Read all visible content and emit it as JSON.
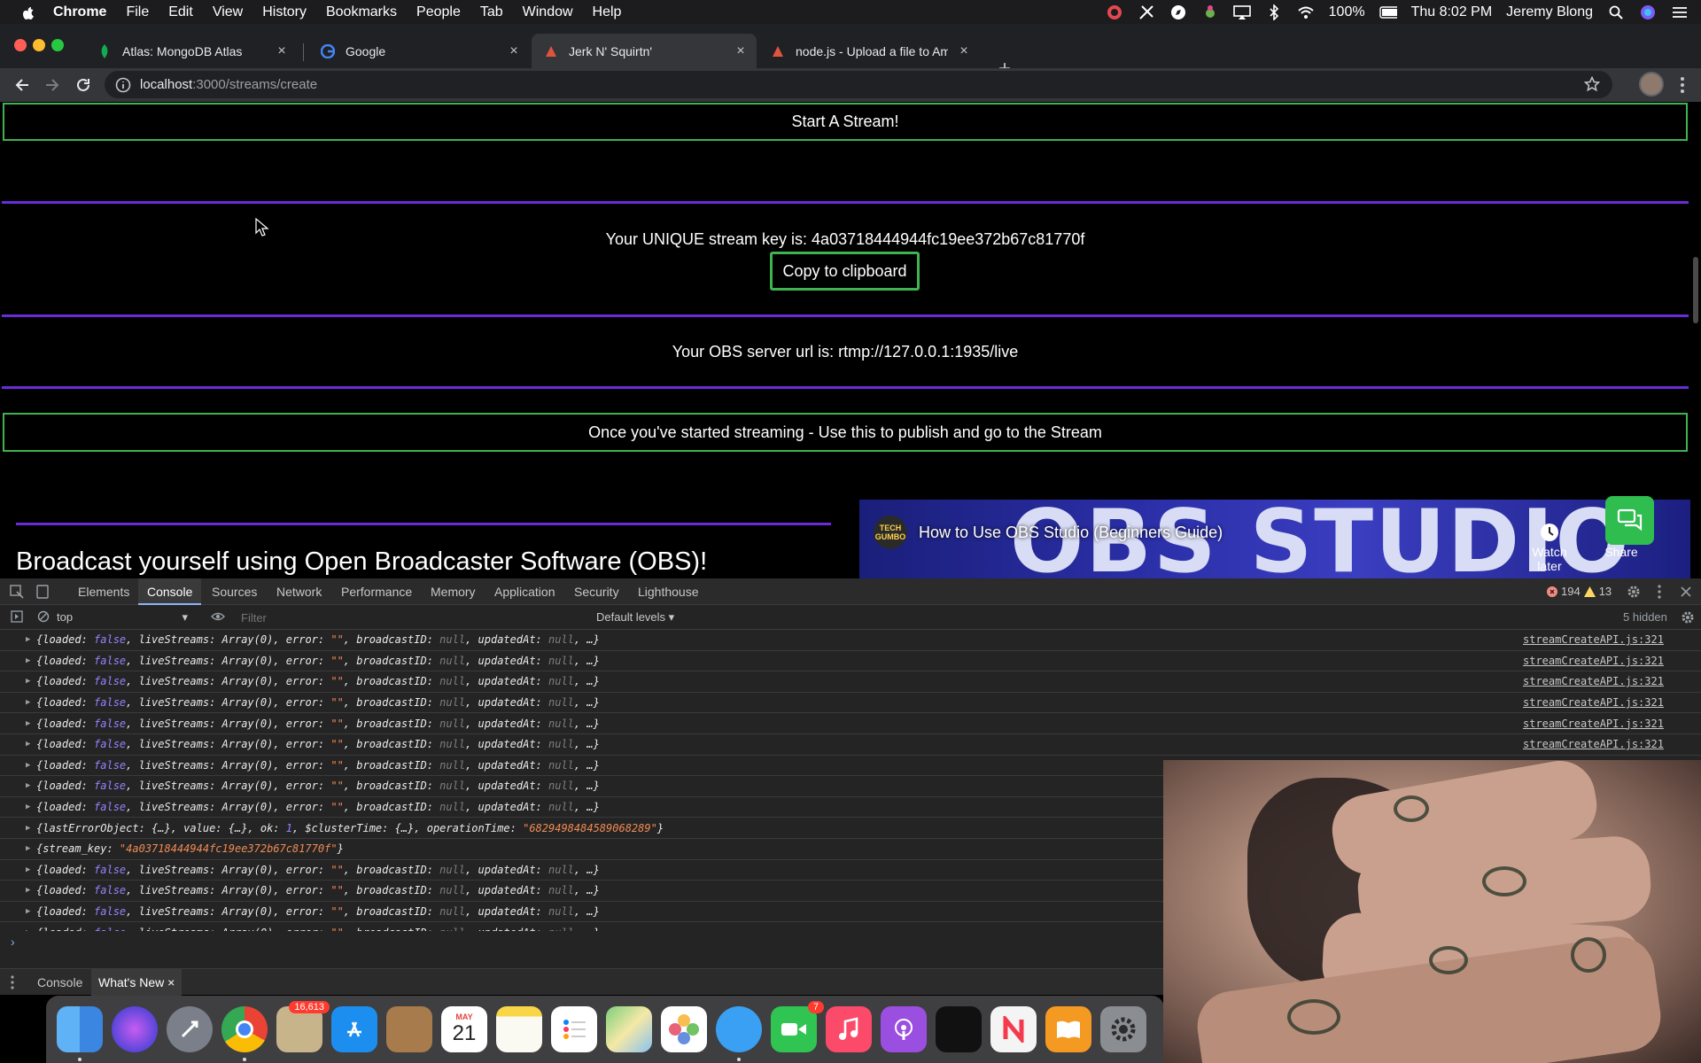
{
  "menubar": {
    "app": "Chrome",
    "items": [
      "File",
      "Edit",
      "View",
      "History",
      "Bookmarks",
      "People",
      "Tab",
      "Window",
      "Help"
    ],
    "battery": "100%",
    "datetime": "Thu 8:02 PM",
    "user": "Jeremy Blong"
  },
  "tabs": [
    {
      "label": "Atlas: MongoDB Atlas",
      "icon": "leaf-icon"
    },
    {
      "label": "Google",
      "icon": "google-icon"
    },
    {
      "label": "Jerk N' Squirtn'",
      "icon": "app-favicon-icon",
      "active": true
    },
    {
      "label": "node.js - Upload a file to Amaz",
      "icon": "app-favicon-icon"
    }
  ],
  "omnibox": {
    "host": "localhost",
    "path": ":3000/streams/create"
  },
  "page": {
    "start_stream": "Start A Stream!",
    "stream_key_text": "Your UNIQUE stream key is: 4a03718444944fc19ee372b67c81770f",
    "copy_button": "Copy to clipboard",
    "obs_url_text": "Your OBS server url is: rtmp://127.0.0.1:1935/live",
    "publish_text": "Once you've started streaming - Use this to publish and go to the Stream",
    "obs_heading": "Broadcast yourself using Open Broadcaster Software (OBS)!",
    "video": {
      "big_text": "OBS STUDIO",
      "channel": "TECH GUMBO",
      "title": "How to Use OBS Studio (Beginners Guide)",
      "watch_later": "Watch later",
      "share": "Share"
    }
  },
  "devtools": {
    "tabs": [
      "Elements",
      "Console",
      "Sources",
      "Network",
      "Performance",
      "Memory",
      "Application",
      "Security",
      "Lighthouse"
    ],
    "active_tab": "Console",
    "errors": "194",
    "warnings": "13",
    "context": "top",
    "filter_placeholder": "Filter",
    "levels": "Default levels",
    "hidden": "5 hidden",
    "source": "streamCreateAPI.js:321",
    "state_row": {
      "p1": "{loaded: ",
      "v1": "false",
      "p2": ", liveStreams: Array(0), error: ",
      "v2": "\"\"",
      "p3": ", broadcastID: ",
      "v3": "null",
      "p4": ", updatedAt: ",
      "v4": "null",
      "p5": ", …}"
    },
    "mongo_row": {
      "p1": "{lastErrorObject: {…}, value: {…}, ok: ",
      "v1": "1",
      "p2": ", $clusterTime: {…}, operationTime: ",
      "v2": "\"6829498484589068289\"",
      "p3": "}"
    },
    "key_row": {
      "p1": "{stream_key: ",
      "v1": "\"4a03718444944fc19ee372b67c81770f\"",
      "p2": "}"
    },
    "drawer_tabs": [
      "Console",
      "What's New"
    ]
  },
  "dock": {
    "mail_badge": "16,613",
    "calendar_month": "MAY",
    "calendar_day": "21",
    "facetime_badge": "7"
  }
}
